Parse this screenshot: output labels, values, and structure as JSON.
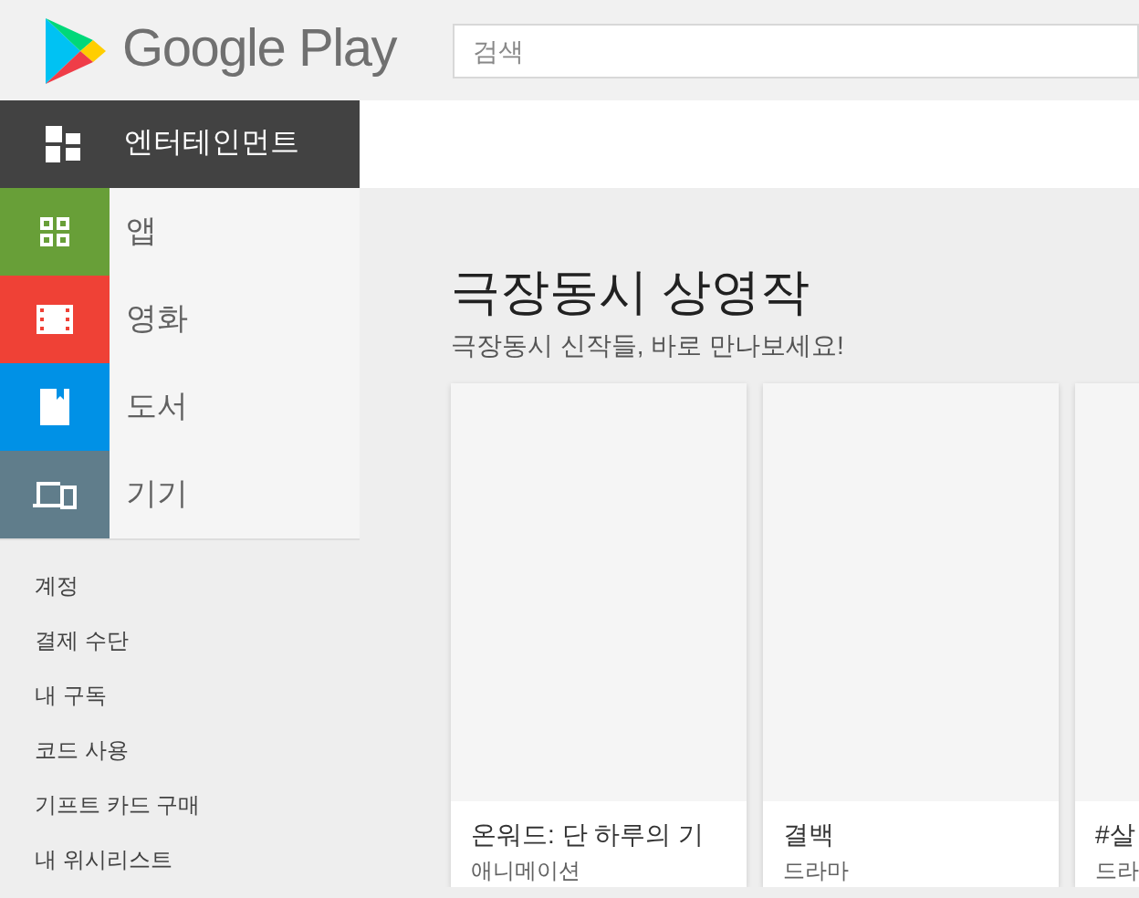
{
  "header": {
    "logo_text": "Google Play",
    "search": {
      "placeholder": "검색"
    }
  },
  "sidebar": {
    "section": {
      "label": "엔터테인먼트"
    },
    "categories": [
      {
        "label": "앱",
        "kind": "apps",
        "color": "#689f38"
      },
      {
        "label": "영화",
        "kind": "movies",
        "color": "#ef4136"
      },
      {
        "label": "도서",
        "kind": "books",
        "color": "#0091e6"
      },
      {
        "label": "기기",
        "kind": "devices",
        "color": "#607d8b"
      }
    ],
    "links": [
      "계정",
      "결제 수단",
      "내 구독",
      "코드 사용",
      "기프트 카드 구매",
      "내 위시리스트"
    ]
  },
  "main": {
    "title": "극장동시 상영작",
    "subtitle": "극장동시 신작들, 바로 만나보세요!",
    "cards": [
      {
        "title": "온워드: 단 하루의 기",
        "genre": "애니메이션"
      },
      {
        "title": "결백",
        "genre": "드라마"
      },
      {
        "title": "#살",
        "genre": "드라"
      }
    ]
  }
}
